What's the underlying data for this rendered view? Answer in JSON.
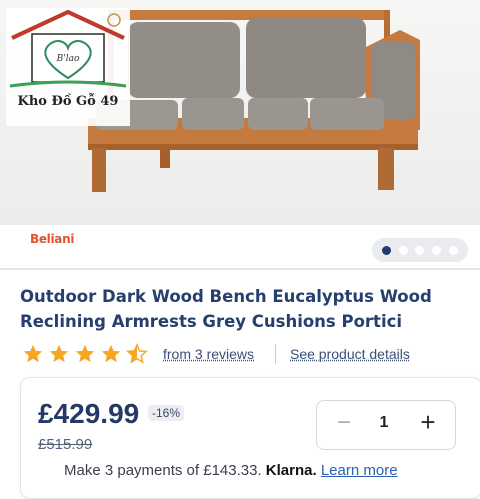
{
  "watermark": {
    "caption": "Kho Đồ Gỗ 49",
    "monogram": "B'lao"
  },
  "gallery": {
    "brand": "Beliani",
    "dot_count": 5,
    "active_dot": 1
  },
  "product": {
    "title_line1": "Outdoor Dark Wood Bench Eucalyptus Wood",
    "title_line2": "Reclining Armrests Grey Cushions Portici",
    "rating": 4.5,
    "reviews_link": "from 3 reviews",
    "details_link": "See product details"
  },
  "price": {
    "current": "£429.99",
    "discount": "-16%",
    "was": "£515.99"
  },
  "quantity": {
    "minus": "−",
    "value": "1",
    "plus": "+"
  },
  "payments": {
    "prefix": "Make 3 payments of £143.33.",
    "provider": "Klarna.",
    "learn_more": "Learn more"
  },
  "colors": {
    "title": "#263f6e",
    "star": "#f5a623",
    "brand": "#e2532d",
    "link": "#2b5fb3"
  }
}
